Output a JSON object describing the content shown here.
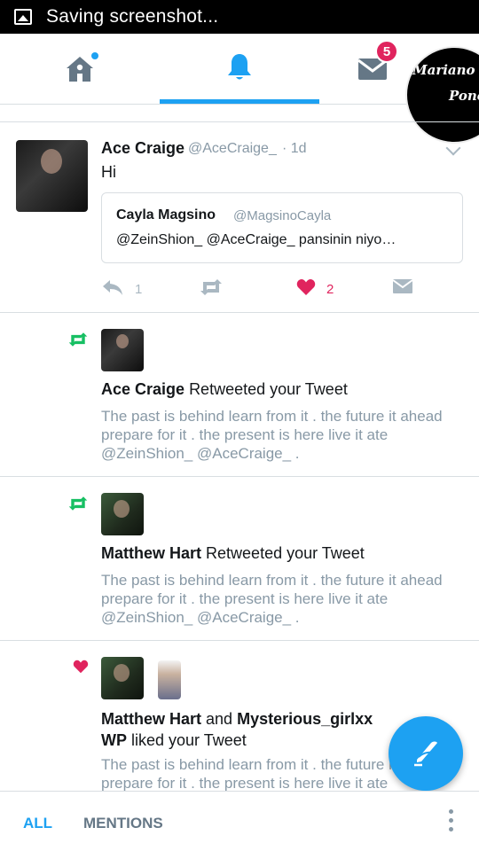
{
  "status_bar": {
    "text": "Saving screenshot..."
  },
  "nav": {
    "tabs": [
      {
        "name": "home",
        "icon": "home-icon"
      },
      {
        "name": "notifications",
        "icon": "bell-icon"
      },
      {
        "name": "messages",
        "icon": "envelope-icon"
      }
    ],
    "messages_badge": "5",
    "active_tab": "notifications"
  },
  "overlay_bubble": {
    "line1": "Mariano",
    "line2": "Ponc"
  },
  "tweet": {
    "name": "Ace Craige",
    "handle": "@AceCraige_",
    "time": "· 1d",
    "text": "Hi",
    "quote": {
      "name": "Cayla Magsino",
      "handle": "@MagsinoCayla",
      "text": "@ZeinShion_ @AceCraige_  pansinin niyo…"
    },
    "actions": {
      "reply_count": "1",
      "like_count": "2"
    }
  },
  "notifications": [
    {
      "type": "retweet",
      "actor": "Ace Craige",
      "action": "Retweeted your Tweet",
      "body": "The past is behind learn from it . the future it ahead prepare for it . the present is here live it ate @ZeinShion_ @AceCraige_ ."
    },
    {
      "type": "retweet",
      "actor": "Matthew Hart",
      "action": "Retweeted your Tweet",
      "body": "The past is behind learn from it . the future it ahead prepare for it . the present is here live it ate @ZeinShion_ @AceCraige_ ."
    },
    {
      "type": "like",
      "actor": "Matthew Hart",
      "connector": "and",
      "actor2": "Mysterious_girlxx WP",
      "action": "liked your Tweet",
      "body": "The past is behind learn from it . the future it ahead prepare for it . the present is here live it ate"
    }
  ],
  "bottom_bar": {
    "tab_all": "ALL",
    "tab_mentions": "MENTIONS"
  },
  "colors": {
    "accent": "#1da1f2",
    "like": "#e0245e",
    "retweet": "#17bf63",
    "muted": "#8899a6"
  }
}
